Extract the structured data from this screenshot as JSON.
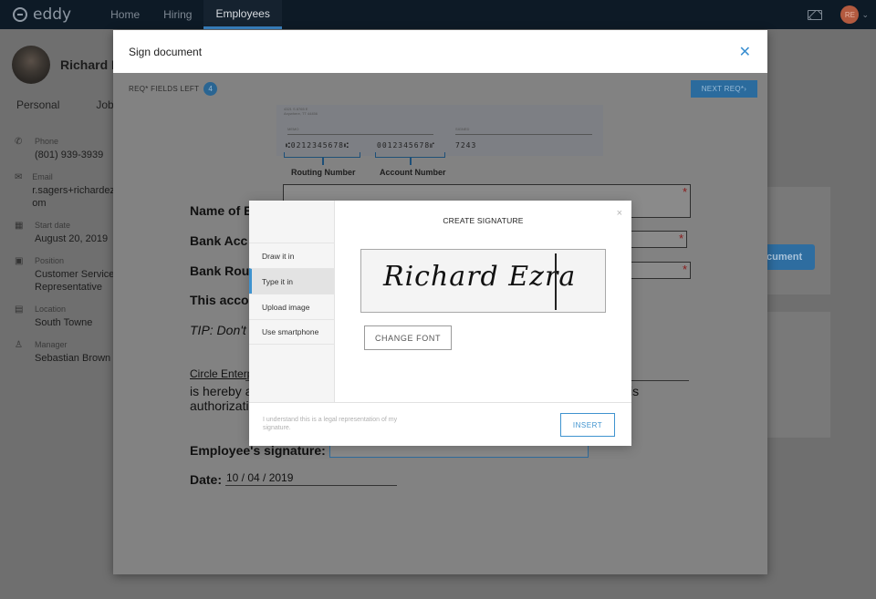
{
  "app": {
    "logo_text": "eddy",
    "nav": [
      "Home",
      "Hiring",
      "Employees"
    ],
    "active_nav": "Employees",
    "user_initials": "RE",
    "user_menu_chevron": "⌄",
    "mail_icon": "mail-icon"
  },
  "profile": {
    "name": "Richard E",
    "tabs": [
      "Personal",
      "Job"
    ],
    "info": [
      {
        "icon": "phone-icon",
        "glyph": "✆",
        "label": "Phone",
        "value": "(801) 939-3939"
      },
      {
        "icon": "email-icon",
        "glyph": "✉",
        "label": "Email",
        "value": "r.sagers+richardez\nom"
      },
      {
        "icon": "calendar-icon",
        "glyph": "▦",
        "label": "Start date",
        "value": "August 20, 2019"
      },
      {
        "icon": "briefcase-icon",
        "glyph": "▣",
        "label": "Position",
        "value": "Customer Service\nRepresentative"
      },
      {
        "icon": "building-icon",
        "glyph": "▤",
        "label": "Location",
        "value": "South Towne"
      },
      {
        "icon": "manager-icon",
        "glyph": "♙",
        "label": "Manager",
        "value": "Sebastian Brown"
      }
    ],
    "document_button_peek": "cument"
  },
  "sign_modal": {
    "title": "Sign document",
    "close_glyph": "✕",
    "req_fields_label": "REQ* FIELDS LEFT",
    "req_fields_count": "4",
    "next_req_label": "NEXT REQ*›"
  },
  "document": {
    "check": {
      "address_line1": "4321 S 8765 E",
      "address_line2": "Anywhere, TT 44456",
      "memo_label": "MEMO",
      "signed_label": "SIGNED",
      "micr_routing": "⑆0212345678⑆",
      "micr_account": "0012345678⑈",
      "micr_check": "7243"
    },
    "routing_label": "Routing Number",
    "account_label": "Account Number",
    "name_label": "Name of E",
    "bank_acc_label": "Bank Acc",
    "bank_routing_label": "Bank Rou",
    "this_acc_label": "This acco",
    "required_marker": "*",
    "tip": "TIP: Don't",
    "company": "Circle Enterp",
    "hereby": "is hereby a",
    "authorization": "authorizati",
    "is_text": "is",
    "employee_signature_label": "Employee's signature:",
    "date_label": "Date:",
    "date_value": "10 / 04 / 2019"
  },
  "signature_dialog": {
    "title": "CREATE SIGNATURE",
    "close_glyph": "×",
    "options": [
      "Draw it in",
      "Type it in",
      "Upload image",
      "Use smartphone"
    ],
    "active_option": "Type it in",
    "typed_signature": "Richard Ezra",
    "change_font_label": "CHANGE FONT",
    "legal_text": "I understand this is a legal representation of my signature.",
    "insert_label": "INSERT"
  }
}
